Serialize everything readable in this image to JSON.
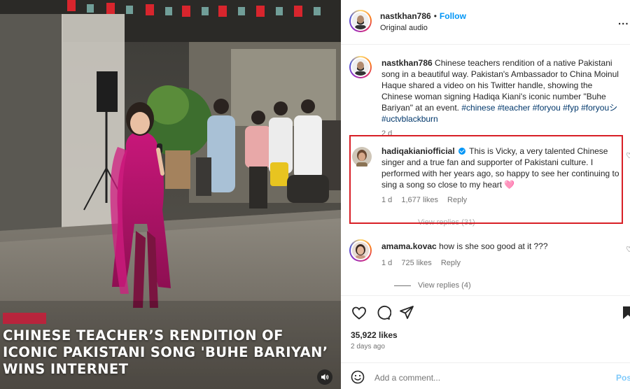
{
  "media": {
    "overlay_tag": "",
    "overlay_title": "CHINESE TEACHER’S RENDITION OF ICONIC PAKISTANI SONG 'BUHE BARIYAN’ WINS INTERNET"
  },
  "header": {
    "username": "nastkhan786",
    "separator": "•",
    "follow_label": "Follow",
    "audio_label": "Original audio",
    "more_label": "..."
  },
  "caption": {
    "username": "nastkhan786",
    "text": "Chinese teachers rendition of a native Pakistani song in a beautiful way. Pakistan's Ambassador to China Moinul Haque shared a video on his Twitter handle, showing the Chinese woman signing Hadiqa Kiani's iconic number \"Buhe Bariyan\" at an event.",
    "hashtags": "#chinese #teacher #foryou #fyp #foryouシ #uctvblackburn",
    "time": "2 d"
  },
  "comments": [
    {
      "username": "hadiqakianiofficial",
      "verified": true,
      "text": "This is Vicky, a very talented Chinese singer and a true fan and supporter of Pakistani culture. I performed with her years ago, so happy to see her continuing to sing a song so close to my heart 🩷",
      "time": "1 d",
      "likes": "1,677 likes",
      "reply": "Reply",
      "view_replies": "View replies (31)"
    },
    {
      "username": "amama.kovac",
      "verified": false,
      "text": "how is she soo good at it ???",
      "time": "1 d",
      "likes": "725 likes",
      "reply": "Reply",
      "view_replies": "View replies (4)"
    }
  ],
  "footer": {
    "likes": "35,922 likes",
    "posted": "2 days ago",
    "comment_placeholder": "Add a comment...",
    "post_label": "Post"
  },
  "icons": {
    "heart": "heart-icon",
    "comment": "comment-icon",
    "share": "send-icon",
    "save": "bookmark-icon",
    "emoji": "emoji-icon",
    "sound": "speaker-icon"
  },
  "colors": {
    "link_blue": "#0095f6",
    "hashtag": "#00376b",
    "highlight_border": "#d81f26",
    "overlay_tag": "#c21f3a"
  }
}
